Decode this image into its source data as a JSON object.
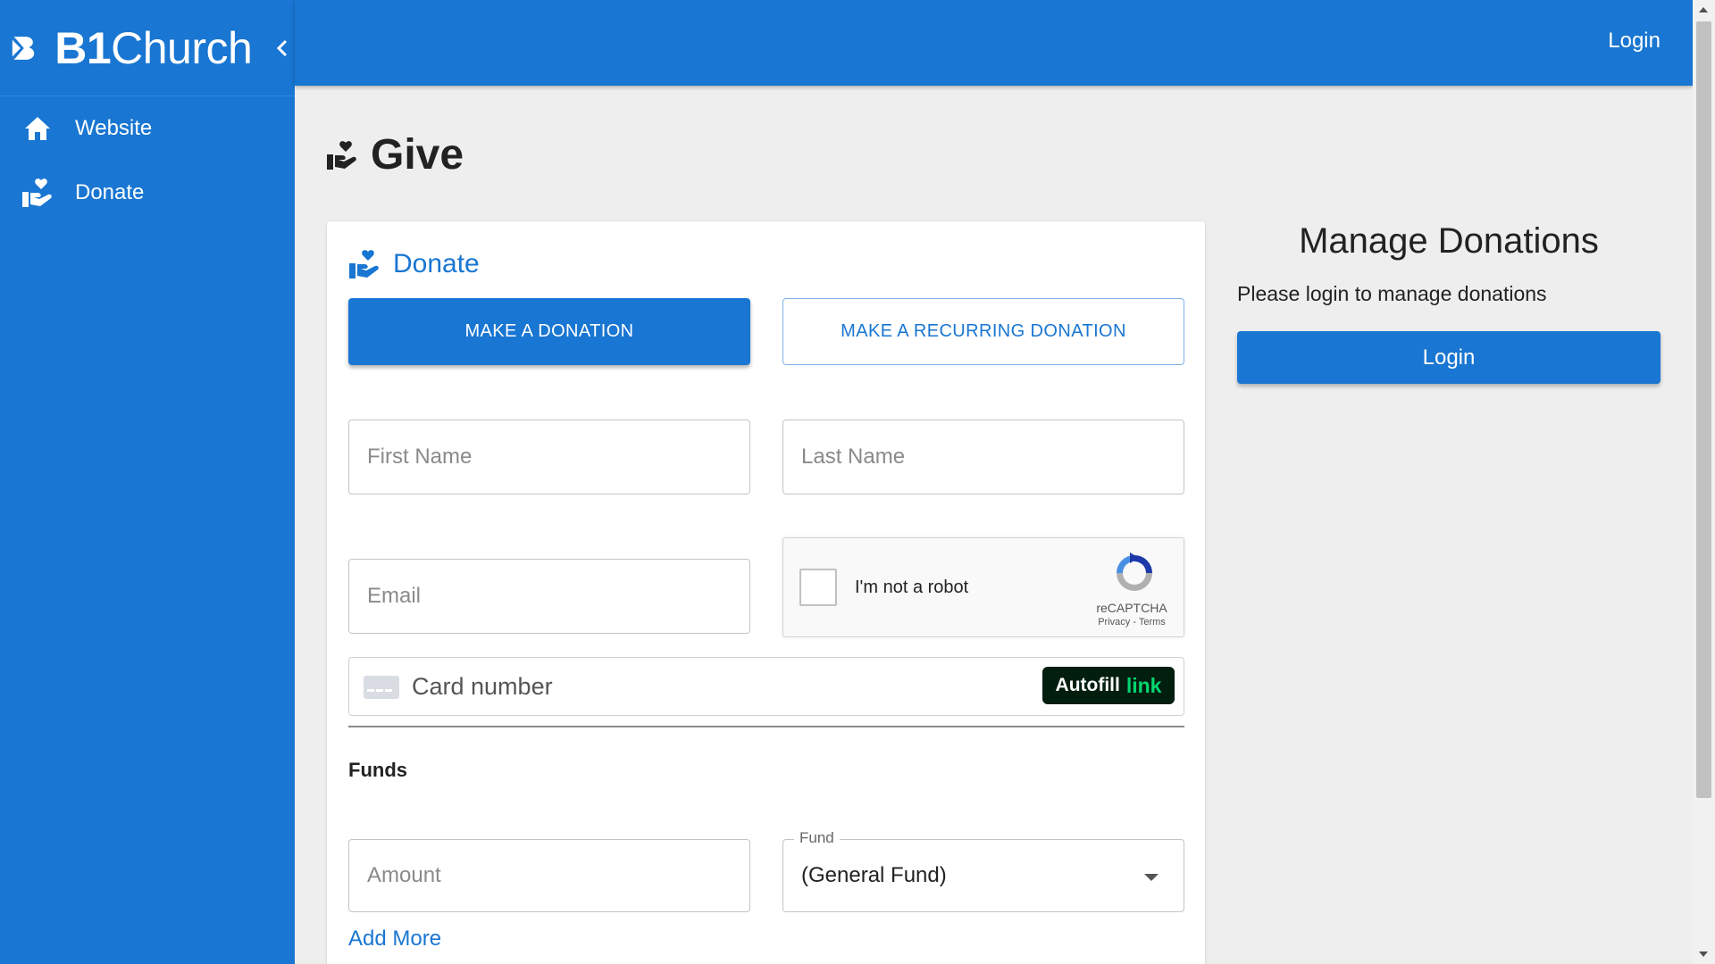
{
  "brand": {
    "name_bold": "B1",
    "name_light": "Church"
  },
  "sidebar": {
    "items": [
      {
        "label": "Website",
        "icon": "home-icon"
      },
      {
        "label": "Donate",
        "icon": "hand-heart-icon"
      }
    ]
  },
  "topbar": {
    "login_label": "Login"
  },
  "page": {
    "title": "Give"
  },
  "donate_card": {
    "heading": "Donate",
    "make_donation_label": "MAKE A DONATION",
    "recurring_donation_label": "MAKE A RECURRING DONATION",
    "first_name_placeholder": "First Name",
    "last_name_placeholder": "Last Name",
    "email_placeholder": "Email",
    "captcha": {
      "label": "I'm not a robot",
      "brand": "reCAPTCHA",
      "links": "Privacy - Terms"
    },
    "card_number_placeholder": "Card number",
    "autofill": {
      "text": "Autofill",
      "link": "link"
    },
    "funds_label": "Funds",
    "amount_placeholder": "Amount",
    "fund_legend": "Fund",
    "fund_value": "(General Fund)",
    "add_more_label": "Add More"
  },
  "manage": {
    "title": "Manage Donations",
    "text": "Please login to manage donations",
    "login_label": "Login"
  },
  "colors": {
    "primary": "#1976d2",
    "background": "#eeeeee",
    "link_green": "#00d66f"
  }
}
